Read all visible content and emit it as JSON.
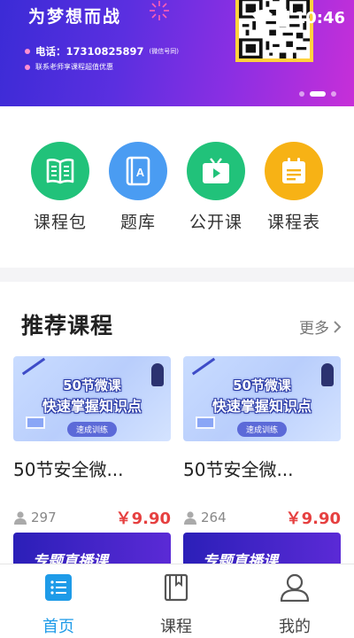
{
  "banner": {
    "slogan": "为梦想而战",
    "phone": "电话：17310825897",
    "phone_note": "(微信号同)",
    "teacher_note": "联系老师享课程超值优惠",
    "indicator_count": 3,
    "indicator_active": 1
  },
  "status_bar": {
    "time": "10:46"
  },
  "categories": [
    {
      "label": "课程包",
      "icon": "book-open-icon",
      "color": "#21c27a"
    },
    {
      "label": "题库",
      "icon": "question-bank-icon",
      "color": "#4a9cf2"
    },
    {
      "label": "公开课",
      "icon": "tv-play-icon",
      "color": "#21c27a"
    },
    {
      "label": "课程表",
      "icon": "calendar-icon",
      "color": "#f7b215"
    }
  ],
  "recommend": {
    "title": "推荐课程",
    "more": "更多",
    "courses": [
      {
        "thumb_line1": "50节微课",
        "thumb_line2": "快速掌握知识点",
        "thumb_tag": "速成训练",
        "name": "50节安全微...",
        "views": "297",
        "price": "￥9.90"
      },
      {
        "thumb_line1": "50节微课",
        "thumb_line2": "快速掌握知识点",
        "thumb_tag": "速成训练",
        "name": "50节安全微...",
        "views": "264",
        "price": "￥9.90"
      }
    ],
    "next_row": [
      {
        "thumb_text": "专题直播课"
      },
      {
        "thumb_text": "专题直播课"
      }
    ]
  },
  "tabbar": [
    {
      "label": "首页",
      "icon": "home-list-icon",
      "active": true
    },
    {
      "label": "课程",
      "icon": "book-icon",
      "active": false
    },
    {
      "label": "我的",
      "icon": "user-icon",
      "active": false
    }
  ],
  "colors": {
    "accent": "#1e9be8",
    "price": "#e64040",
    "banner_start": "#3b2bd6",
    "banner_end": "#c72fd8"
  }
}
